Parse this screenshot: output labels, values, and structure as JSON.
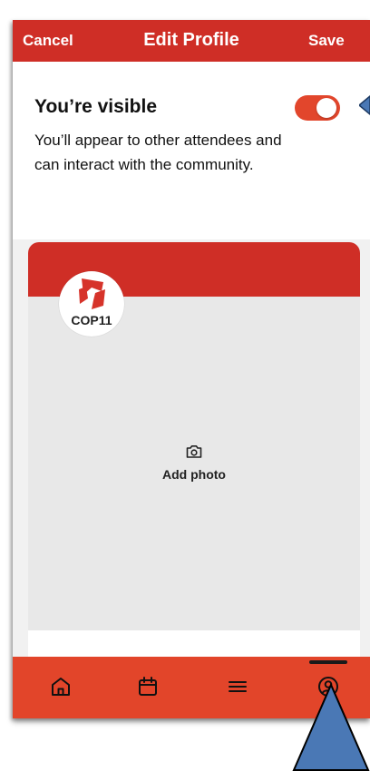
{
  "header": {
    "cancel_label": "Cancel",
    "title": "Edit Profile",
    "save_label": "Save",
    "background": "#cf2e26"
  },
  "visibility": {
    "title": "You’re visible",
    "description": "You’ll appear to other attendees and can interact with the community.",
    "toggle_on": true,
    "toggle_color": "#e2462c"
  },
  "profile": {
    "logo_text": "COP11",
    "add_photo_label": "Add photo",
    "camera_icon": "camera-icon"
  },
  "tabbar": {
    "background": "#e2452a",
    "tabs": [
      {
        "icon": "home-icon",
        "active": false
      },
      {
        "icon": "calendar-icon",
        "active": false
      },
      {
        "icon": "menu-icon",
        "active": false
      },
      {
        "icon": "profile-icon",
        "active": true
      }
    ]
  },
  "annotation": {
    "pointer_color": "#4a78b5"
  }
}
